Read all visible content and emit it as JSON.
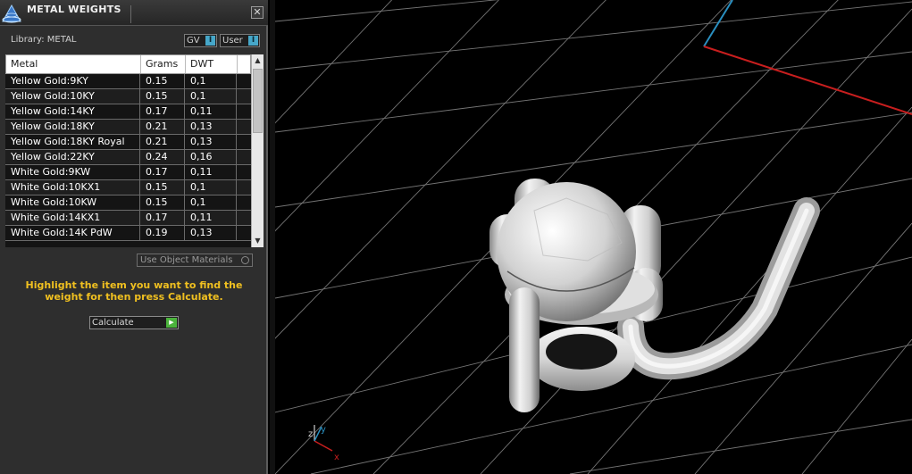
{
  "panel": {
    "title": "METAL WEIGHTS",
    "library_label": "Library: METAL",
    "toggles": [
      {
        "label": "GV",
        "knob": "I"
      },
      {
        "label": "User",
        "knob": "I"
      }
    ],
    "close_symbol": "✕"
  },
  "table": {
    "columns": [
      "Metal",
      "Grams",
      "DWT"
    ],
    "rows": [
      {
        "metal": "Yellow Gold:9KY",
        "grams": "0.15",
        "dwt": "0,1"
      },
      {
        "metal": "Yellow Gold:10KY",
        "grams": "0.15",
        "dwt": "0,1"
      },
      {
        "metal": "Yellow Gold:14KY",
        "grams": "0.17",
        "dwt": "0,11"
      },
      {
        "metal": "Yellow Gold:18KY",
        "grams": "0.21",
        "dwt": "0,13"
      },
      {
        "metal": "Yellow Gold:18KY Royal",
        "grams": "0.21",
        "dwt": "0,13"
      },
      {
        "metal": "Yellow Gold:22KY",
        "grams": "0.24",
        "dwt": "0,16"
      },
      {
        "metal": "White Gold:9KW",
        "grams": "0.17",
        "dwt": "0,11"
      },
      {
        "metal": "White Gold:10KX1",
        "grams": "0.15",
        "dwt": "0,1"
      },
      {
        "metal": "White Gold:10KW",
        "grams": "0.15",
        "dwt": "0,1"
      },
      {
        "metal": "White Gold:14KX1",
        "grams": "0.17",
        "dwt": "0,11"
      },
      {
        "metal": "White Gold:14K PdW",
        "grams": "0.19",
        "dwt": "0,13"
      }
    ],
    "scroll_up": "▲",
    "scroll_down": "▼"
  },
  "controls": {
    "use_object_materials": "Use Object Materials",
    "hint": "Highlight the item you want to find the weight for then press Calculate.",
    "calculate_label": "Calculate",
    "calculate_icon": "▶"
  },
  "viewport": {
    "axis_labels": {
      "x": "x",
      "y": "y",
      "z": "z"
    },
    "colors": {
      "x_axis": "#c81e1e",
      "y_axis": "#2a8fc0",
      "grid": "#8a8a8a",
      "background": "#000000",
      "model": "#d8d8d8"
    }
  },
  "colors": {
    "hint_text": "#f0c020",
    "toggle_knob": "#46a7c9",
    "calculate_play": "#4bb43c"
  }
}
